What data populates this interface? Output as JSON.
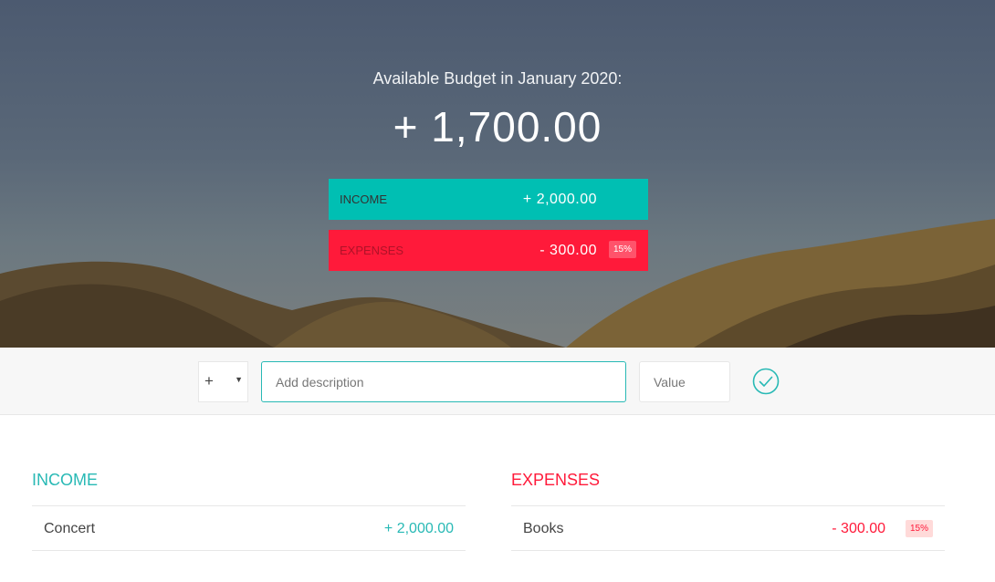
{
  "header": {
    "title": "Available Budget in January 2020:",
    "budget": "+ 1,700.00",
    "income_label": "Income",
    "income_value": "+ 2,000.00",
    "expenses_label": "Expenses",
    "expenses_value": "- 300.00",
    "expenses_percentage": "15%"
  },
  "add_form": {
    "type_value": "+",
    "description_placeholder": "Add description",
    "value_placeholder": "Value",
    "submit_icon": "checkmark-circle-icon"
  },
  "income_list": {
    "title": "Income",
    "items": [
      {
        "description": "Concert",
        "value": "+ 2,000.00"
      }
    ]
  },
  "expenses_list": {
    "title": "Expenses",
    "items": [
      {
        "description": "Books",
        "value": "- 300.00",
        "percentage": "15%"
      }
    ]
  },
  "colors": {
    "income": "#28b9b5",
    "income_bg": "#00bfb3",
    "expenses": "#ff1a3a"
  }
}
